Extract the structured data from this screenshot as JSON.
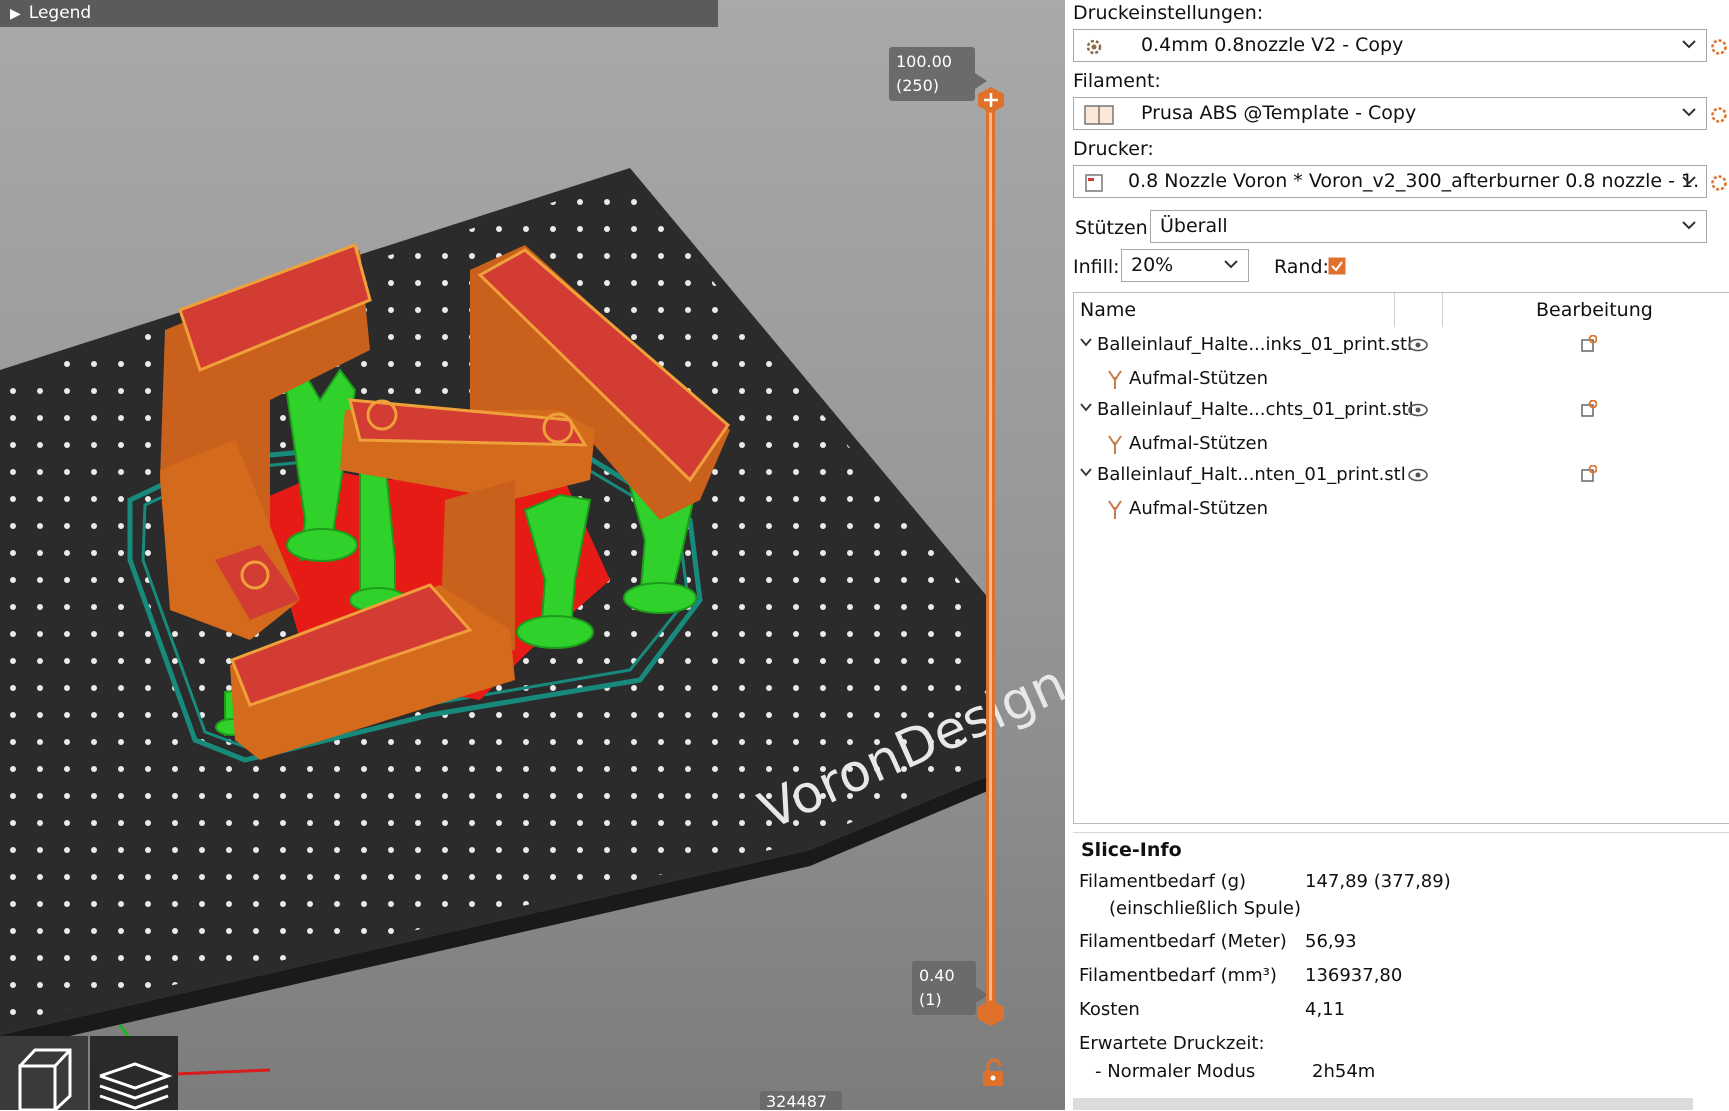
{
  "legend": {
    "label": "Legend"
  },
  "viewport": {
    "bed_logo": "VoronDesign",
    "slider_top": {
      "value": "100.00",
      "layer": "(250)"
    },
    "slider_bottom": {
      "value": "0.40",
      "layer": "(1)"
    },
    "moves_counter": "324487",
    "colors": {
      "model": "#d46a1c",
      "top_surface": "#d23c32",
      "support": "#2fd12a",
      "skirt": "#178a7c",
      "bed": "#2b2b2b",
      "accent": "#e0712a"
    }
  },
  "settings": {
    "print_label": "Druckeinstellungen:",
    "print_value": "0.4mm 0.8nozzle V2 - Copy",
    "filament_label": "Filament:",
    "filament_value": "Prusa ABS @Template - Copy",
    "printer_label": "Drucker:",
    "printer_value": "0.8 Nozzle Voron  * Voron_v2_300_afterburner 0.8 nozzle - 1. ...",
    "supports_label": "Stützen:",
    "supports_value": "Überall",
    "infill_label": "Infill:",
    "infill_value": "20%",
    "brim_label": "Rand:",
    "brim_checked": true
  },
  "object_list": {
    "col_name": "Name",
    "col_edit": "Bearbeitung",
    "objects": [
      {
        "name": "Balleinlauf_Halte...inks_01_print.stl",
        "child": "Aufmal-Stützen"
      },
      {
        "name": "Balleinlauf_Halte...chts_01_print.stl",
        "child": "Aufmal-Stützen"
      },
      {
        "name": "Balleinlauf_Halt...nten_01_print.stl",
        "child": "Aufmal-Stützen"
      }
    ]
  },
  "slice_info": {
    "title": "Slice-Info",
    "rows": [
      {
        "label": "Filamentbedarf (g)",
        "value": "147,89 (377,89)"
      },
      {
        "label": "(einschließlich Spule)",
        "value": ""
      },
      {
        "label": "Filamentbedarf (Meter)",
        "value": "56,93"
      },
      {
        "label": "Filamentbedarf (mm³)",
        "value": "136937,80"
      },
      {
        "label": "Kosten",
        "value": "4,11"
      },
      {
        "label": "Erwartete Druckzeit:",
        "value": ""
      },
      {
        "label": "- Normaler Modus",
        "value": "2h54m"
      }
    ]
  }
}
